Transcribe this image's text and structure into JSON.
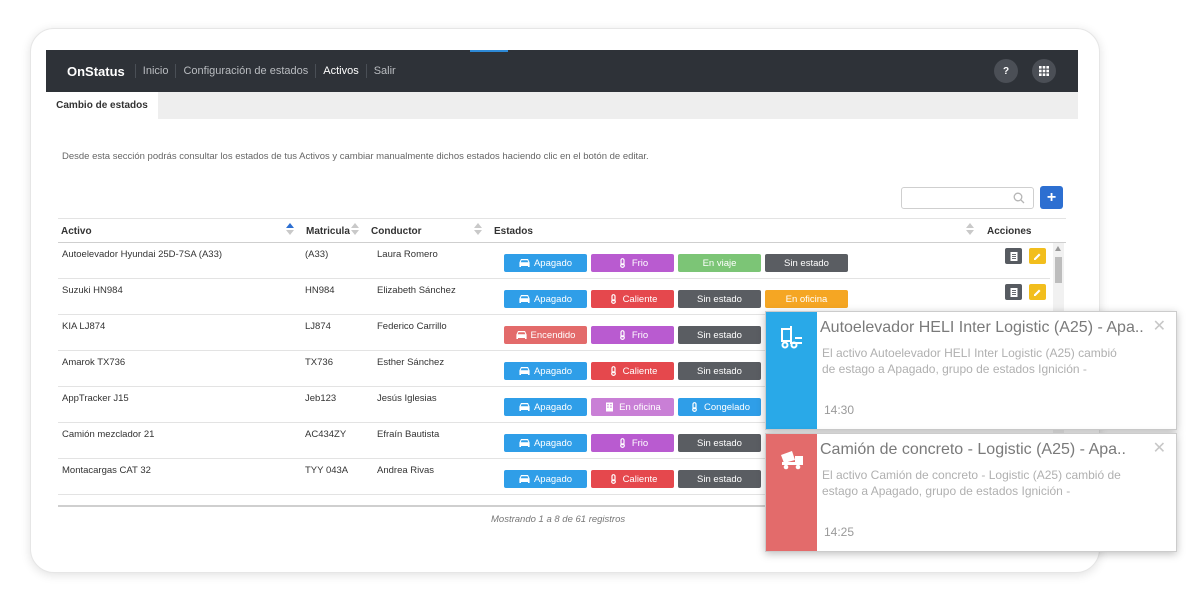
{
  "app": {
    "brand": "OnStatus",
    "nav": [
      "Inicio",
      "Configuración de estados",
      "Activos",
      "Salir"
    ],
    "active_nav": "Activos",
    "help_label": "?"
  },
  "tab": {
    "label": "Cambio de estados"
  },
  "description": "Desde esta sección podrás consultar los estados de tus Activos y cambiar manualmente dichos estados haciendo clic en el botón de editar.",
  "search": {
    "value": "",
    "placeholder": ""
  },
  "add_label": "+",
  "table": {
    "headers": {
      "activo": "Activo",
      "matricula": "Matricula",
      "conductor": "Conductor",
      "estados": "Estados",
      "acciones": "Acciones"
    },
    "rows": [
      {
        "activo": "Autoelevador Hyundai 25D-7SA (A33)",
        "matricula": "(A33)",
        "conductor": "Laura Romero",
        "estados": [
          {
            "label": "Apagado",
            "color": "#2f9ee8",
            "icon": "car-icon"
          },
          {
            "label": "Frio",
            "color": "#b95bd0",
            "icon": "thermometer-icon"
          },
          {
            "label": "En viaje",
            "color": "#7cc576",
            "icon": ""
          },
          {
            "label": "Sin estado",
            "color": "#5a5d62",
            "icon": ""
          }
        ],
        "actions": true
      },
      {
        "activo": "Suzuki HN984",
        "matricula": "HN984",
        "conductor": "Elizabeth Sánchez",
        "estados": [
          {
            "label": "Apagado",
            "color": "#2f9ee8",
            "icon": "car-icon"
          },
          {
            "label": "Caliente",
            "color": "#e5484d",
            "icon": "thermometer-icon"
          },
          {
            "label": "Sin estado",
            "color": "#5a5d62",
            "icon": ""
          },
          {
            "label": "En oficina",
            "color": "#f5a623",
            "icon": ""
          }
        ],
        "actions": true
      },
      {
        "activo": "KIA LJ874",
        "matricula": "LJ874",
        "conductor": "Federico Carrillo",
        "estados": [
          {
            "label": "Encendido",
            "color": "#e36b6b",
            "icon": "car-icon"
          },
          {
            "label": "Frio",
            "color": "#b95bd0",
            "icon": "thermometer-icon"
          },
          {
            "label": "Sin estado",
            "color": "#5a5d62",
            "icon": ""
          }
        ],
        "actions": false
      },
      {
        "activo": "Amarok TX736",
        "matricula": "TX736",
        "conductor": "Esther Sánchez",
        "estados": [
          {
            "label": "Apagado",
            "color": "#2f9ee8",
            "icon": "car-icon"
          },
          {
            "label": "Caliente",
            "color": "#e5484d",
            "icon": "thermometer-icon"
          },
          {
            "label": "Sin estado",
            "color": "#5a5d62",
            "icon": ""
          }
        ],
        "actions": false
      },
      {
        "activo": "AppTracker J15",
        "matricula": "Jeb123",
        "conductor": "Jesús Iglesias",
        "estados": [
          {
            "label": "Apagado",
            "color": "#2f9ee8",
            "icon": "car-icon"
          },
          {
            "label": "En oficina",
            "color": "#c97fd6",
            "icon": "building-icon"
          },
          {
            "label": "Congelado",
            "color": "#2f9ee8",
            "icon": "thermometer-icon"
          }
        ],
        "actions": false
      },
      {
        "activo": "Camión mezclador 21",
        "matricula": "AC434ZY",
        "conductor": "Efraín Bautista",
        "estados": [
          {
            "label": "Apagado",
            "color": "#2f9ee8",
            "icon": "car-icon"
          },
          {
            "label": "Frio",
            "color": "#b95bd0",
            "icon": "thermometer-icon"
          },
          {
            "label": "Sin estado",
            "color": "#5a5d62",
            "icon": ""
          }
        ],
        "actions": false
      },
      {
        "activo": "Montacargas CAT 32",
        "matricula": "TYY 043A",
        "conductor": "Andrea Rivas",
        "estados": [
          {
            "label": "Apagado",
            "color": "#2f9ee8",
            "icon": "car-icon"
          },
          {
            "label": "Caliente",
            "color": "#e5484d",
            "icon": "thermometer-icon"
          },
          {
            "label": "Sin estado",
            "color": "#5a5d62",
            "icon": ""
          }
        ],
        "actions": false
      }
    ],
    "footer": "Mostrando 1 a 8 de 61 registros"
  },
  "notifications": [
    {
      "title": "Autoelevador HELI Inter Logistic (A25) - Apa..",
      "body": "El activo Autoelevador HELI Inter Logistic (A25) cambió de estago a Apagado, grupo de estados Ignición -",
      "time": "14:30",
      "color": "#29a9e8",
      "icon": "forklift-icon"
    },
    {
      "title": "Camión de concreto - Logistic (A25) - Apa..",
      "body": "El activo Camión de concreto - Logistic (A25) cambió de estago a Apagado, grupo de estados Ignición -",
      "time": "14:25",
      "color": "#e36b6b",
      "icon": "mixer-truck-icon"
    }
  ]
}
